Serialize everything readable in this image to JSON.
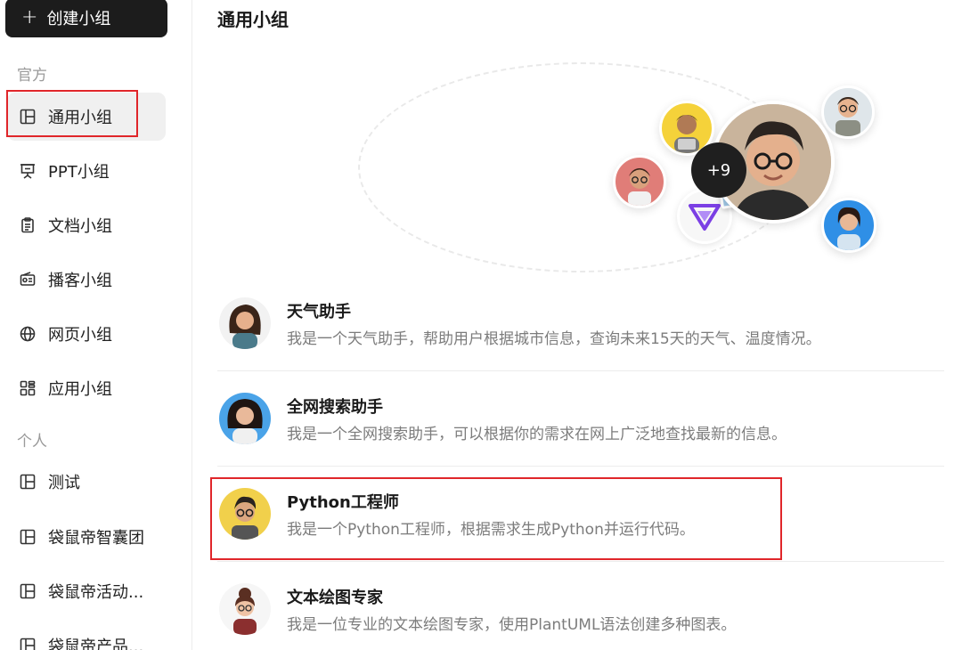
{
  "sidebar": {
    "create_label": "创建小组",
    "sections": [
      {
        "label": "官方",
        "items": [
          {
            "label": "通用小组",
            "icon": "layout-icon",
            "active": true
          },
          {
            "label": "PPT小组",
            "icon": "presentation-icon"
          },
          {
            "label": "文档小组",
            "icon": "clipboard-icon"
          },
          {
            "label": "播客小组",
            "icon": "radio-icon"
          },
          {
            "label": "网页小组",
            "icon": "globe-icon"
          },
          {
            "label": "应用小组",
            "icon": "apps-icon"
          }
        ]
      },
      {
        "label": "个人",
        "items": [
          {
            "label": "测试",
            "icon": "layout-icon"
          },
          {
            "label": "袋鼠帝智囊团",
            "icon": "layout-icon"
          },
          {
            "label": "袋鼠帝活动...",
            "icon": "layout-icon"
          },
          {
            "label": "袋鼠帝产品...",
            "icon": "layout-icon"
          }
        ]
      }
    ]
  },
  "main": {
    "title": "通用小组",
    "hero": {
      "more_count": "+9"
    },
    "agents": [
      {
        "name": "天气助手",
        "desc": "我是一个天气助手，帮助用户根据城市信息，查询未来15天的天气、温度情况。",
        "avatar": "woman-dark-hair-avatar"
      },
      {
        "name": "全网搜索助手",
        "desc": "我是一个全网搜索助手，可以根据你的需求在网上广泛地查找最新的信息。",
        "avatar": "woman-curly-hair-avatar"
      },
      {
        "name": "Python工程师",
        "desc": "我是一个Python工程师，根据需求生成Python并运行代码。",
        "avatar": "man-glasses-avatar"
      },
      {
        "name": "文本绘图专家",
        "desc": "我是一位专业的文本绘图专家，使用PlantUML语法创建多种图表。",
        "avatar": "woman-bun-avatar"
      }
    ]
  },
  "colors": {
    "accent_dark": "#1c1c1c",
    "highlight_red": "#e0262a",
    "active_bg": "#f0f0f0"
  }
}
